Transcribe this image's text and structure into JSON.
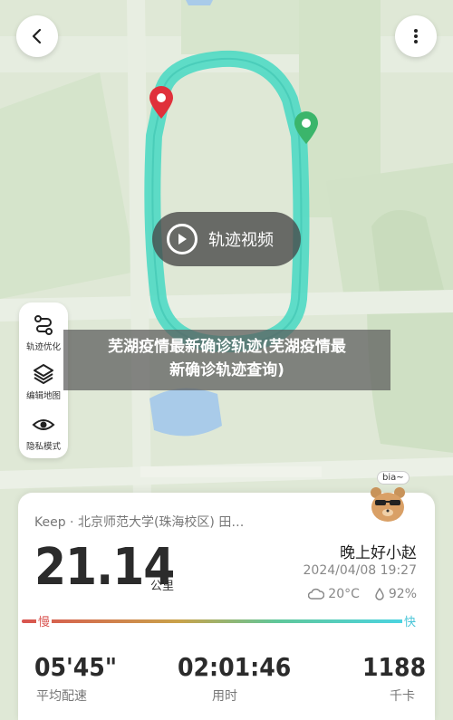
{
  "header": {
    "back_icon": "chevron-left-icon",
    "more_icon": "more-vertical-icon"
  },
  "map": {
    "route_color": "#4fd9c4",
    "start_marker_color": "#3bb56b",
    "end_marker_color": "#e0303b"
  },
  "video_button": {
    "label": "轨迹视频",
    "icon": "play-icon"
  },
  "tools": [
    {
      "label": "轨迹优化",
      "icon": "route-icon"
    },
    {
      "label": "编辑地图",
      "icon": "layers-icon"
    },
    {
      "label": "隐私模式",
      "icon": "eye-icon"
    }
  ],
  "overlay": {
    "line1": "芜湖疫情最新确诊轨迹(芜湖疫情最",
    "line2": "新确诊轨迹查询)"
  },
  "sticker": {
    "text": "bia~"
  },
  "card": {
    "source": "Keep · 北京师范大学(珠海校区) 田…",
    "distance": "21.14",
    "distance_unit": "公里",
    "run_name": "晚上好小赵",
    "datetime": "2024/04/08 19:27",
    "temperature": "20°C",
    "humidity": "92%",
    "pace_slow_label": "慢",
    "pace_fast_label": "快",
    "stats": [
      {
        "value": "05'45\"",
        "label": "平均配速"
      },
      {
        "value": "02:01:46",
        "label": "用时"
      },
      {
        "value": "1188",
        "label": "千卡"
      }
    ]
  }
}
